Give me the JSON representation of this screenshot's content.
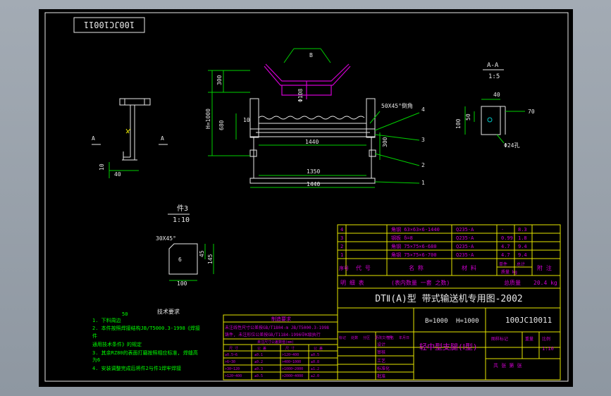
{
  "drawing": {
    "stamp_code": "100JC10011",
    "section_label": "A-A",
    "section_scale": "1:5",
    "part3_label": "件3",
    "part3_scale": "1:10",
    "section_marks": [
      "A",
      "A"
    ],
    "dims": {
      "d300_top": "300",
      "h1000": "H=1000",
      "d680": "680",
      "d10a": "10",
      "d1440a": "1440",
      "d1350": "1350",
      "d1440b": "1440",
      "d300_side": "300",
      "d108": "Φ108",
      "chamfer": "50X45°倒角",
      "angle_b": "B",
      "d40_left": "40",
      "d10_left": "10",
      "d40_aa": "40",
      "d50_aa": "50",
      "d100_aa": "100",
      "d70_aa": "70",
      "hole_aa": "Φ24孔",
      "p3_chamfer": "30X45°",
      "p3_d6": "6",
      "p3_d45": "45",
      "p3_d145": "145",
      "p3_d100": "100"
    },
    "balloons": [
      "4",
      "3",
      "2",
      "1"
    ]
  },
  "notes": {
    "title": "技术要求",
    "roughness": "50",
    "lines": [
      "1. 下料周边",
      "2. 本件按照焊接结构JB/T5000.3-1998《焊接",
      "件",
      "   通用技术条件》的规定",
      "3. 其余RZ80的表面打磨按照相应标准, 焊缝高",
      "   为6",
      "4. 安装调整完成后将件2与件1焊牢焊接"
    ]
  },
  "tolerance_table": {
    "title": "制造要求",
    "lines": [
      "未注线性尺寸公差按GB/T1804-m  JB/T5000.3-1998",
      "铸件, 未注形位公差按GB/T1184-1996中K级执行"
    ],
    "sub_title": "未注尺寸公差数值(mm)",
    "headers": [
      "尺  寸",
      "公  差",
      "尺  寸",
      "公  差"
    ],
    "rows": [
      [
        "≥0.5~6",
        "±0.1",
        ">120~400",
        "±0.5"
      ],
      [
        ">6~30",
        "±0.2",
        ">400~1000",
        "±0.8"
      ],
      [
        ">30~120",
        "±0.3",
        ">1000~2000",
        "±1.2"
      ],
      [
        ">120~400",
        "±0.5",
        ">2000~4000",
        "±2.0"
      ]
    ]
  },
  "bom": {
    "rows": [
      {
        "no": "4",
        "name": "角钢 63×63×6-1440",
        "mat": "Q235-A",
        "qty": "-",
        "wt": "8.3"
      },
      {
        "no": "3",
        "name": "钢板 δ=8",
        "mat": "Q235-A",
        "qty": "0.99",
        "wt": "1.8"
      },
      {
        "no": "2",
        "name": "角钢 75×75×6-680",
        "mat": "Q235-A",
        "qty": "4.7",
        "wt": "9.4"
      },
      {
        "no": "1",
        "name": "角钢 75×75×6-700",
        "mat": "Q235-A",
        "qty": "4.7",
        "wt": "9.4"
      }
    ],
    "header": {
      "no": "序号",
      "code": "代  号",
      "name": "名  称",
      "mat": "材  料",
      "unit_wt": "单件",
      "total_wt": "总计",
      "wt_unit": "质量 kg",
      "remark": "附  注"
    },
    "detail_row": {
      "label": "明    细    表",
      "note": "(表内数量  一套  之数)",
      "total_label": "总质量",
      "total_value": "20.4 kg"
    }
  },
  "title_block": {
    "main_title": "DTⅡ(A)型  带式输送机专用图-2002",
    "param_b": "B=1000",
    "param_h": "H=1000",
    "drawing_no": "100JC10011",
    "part_name": "轻中型支腿(Ⅰ型)",
    "scale_label": "比例",
    "scale_value": "1:10",
    "std_label": "图样标记",
    "mass_label": "重量",
    "sheet_label": "共   张  第   张",
    "rows_left": [
      "标记",
      "处数",
      "分区",
      "更改文件号",
      "签名",
      "年月日"
    ],
    "design": "设计",
    "check": "审核",
    "process": "工艺",
    "std": "标准化",
    "approve": "批准"
  }
}
